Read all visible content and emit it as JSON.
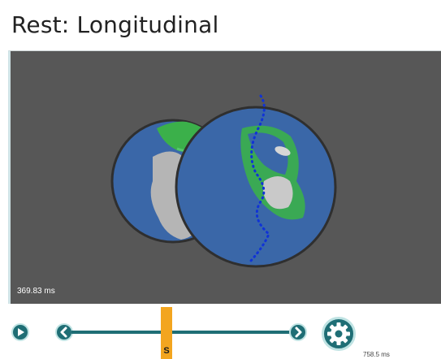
{
  "title": "Rest: Longitudinal",
  "viewport": {
    "time_left": "369.83 ms"
  },
  "controls": {
    "slider_label": "S",
    "time_right": "758.5 ms",
    "icons": {
      "play": "play-icon",
      "prev": "chevron-left-icon",
      "next": "chevron-right-icon",
      "settings": "gear-icon"
    }
  },
  "colors": {
    "accent": "#1f6e75",
    "thumb": "#f3a51f",
    "viewport_bg": "#575757",
    "sphere_blue": "#3a67a8",
    "sphere_green": "#3bb04a",
    "sphere_gray": "#b5b5b5",
    "path_dots": "#1033d6"
  }
}
